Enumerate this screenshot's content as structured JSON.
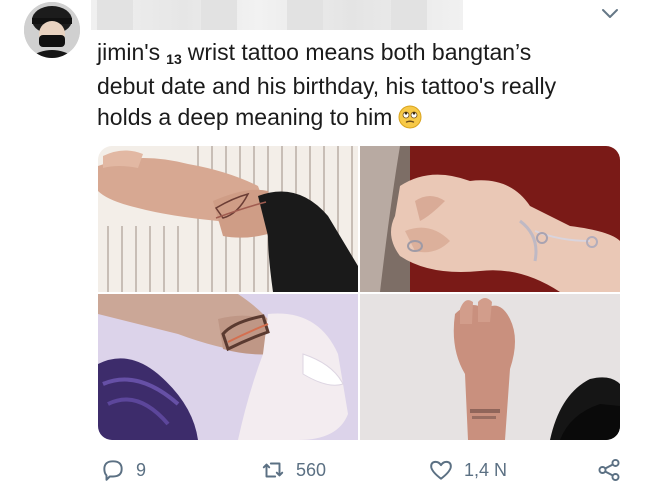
{
  "tweet": {
    "text_line1_a": "jimin's",
    "text_line1_sub": "13",
    "text_line1_b": "wrist tattoo means both bangtan’s",
    "text_line2": "debut date and his birthday, his tattoo's really",
    "text_line3": "holds a deep meaning to him"
  },
  "icons": {
    "avatar": "avatar-image",
    "menu": "chevron-down-icon",
    "emoji": "face-with-rolling-eyes-emoji",
    "reply": "reply-icon",
    "retweet": "retweet-icon",
    "like": "heart-icon",
    "share": "share-icon"
  },
  "actions": {
    "replies": "9",
    "retweets": "560",
    "likes": "1,4 N"
  },
  "colors": {
    "text": "#1b1b1b",
    "muted": "#5b7083"
  }
}
